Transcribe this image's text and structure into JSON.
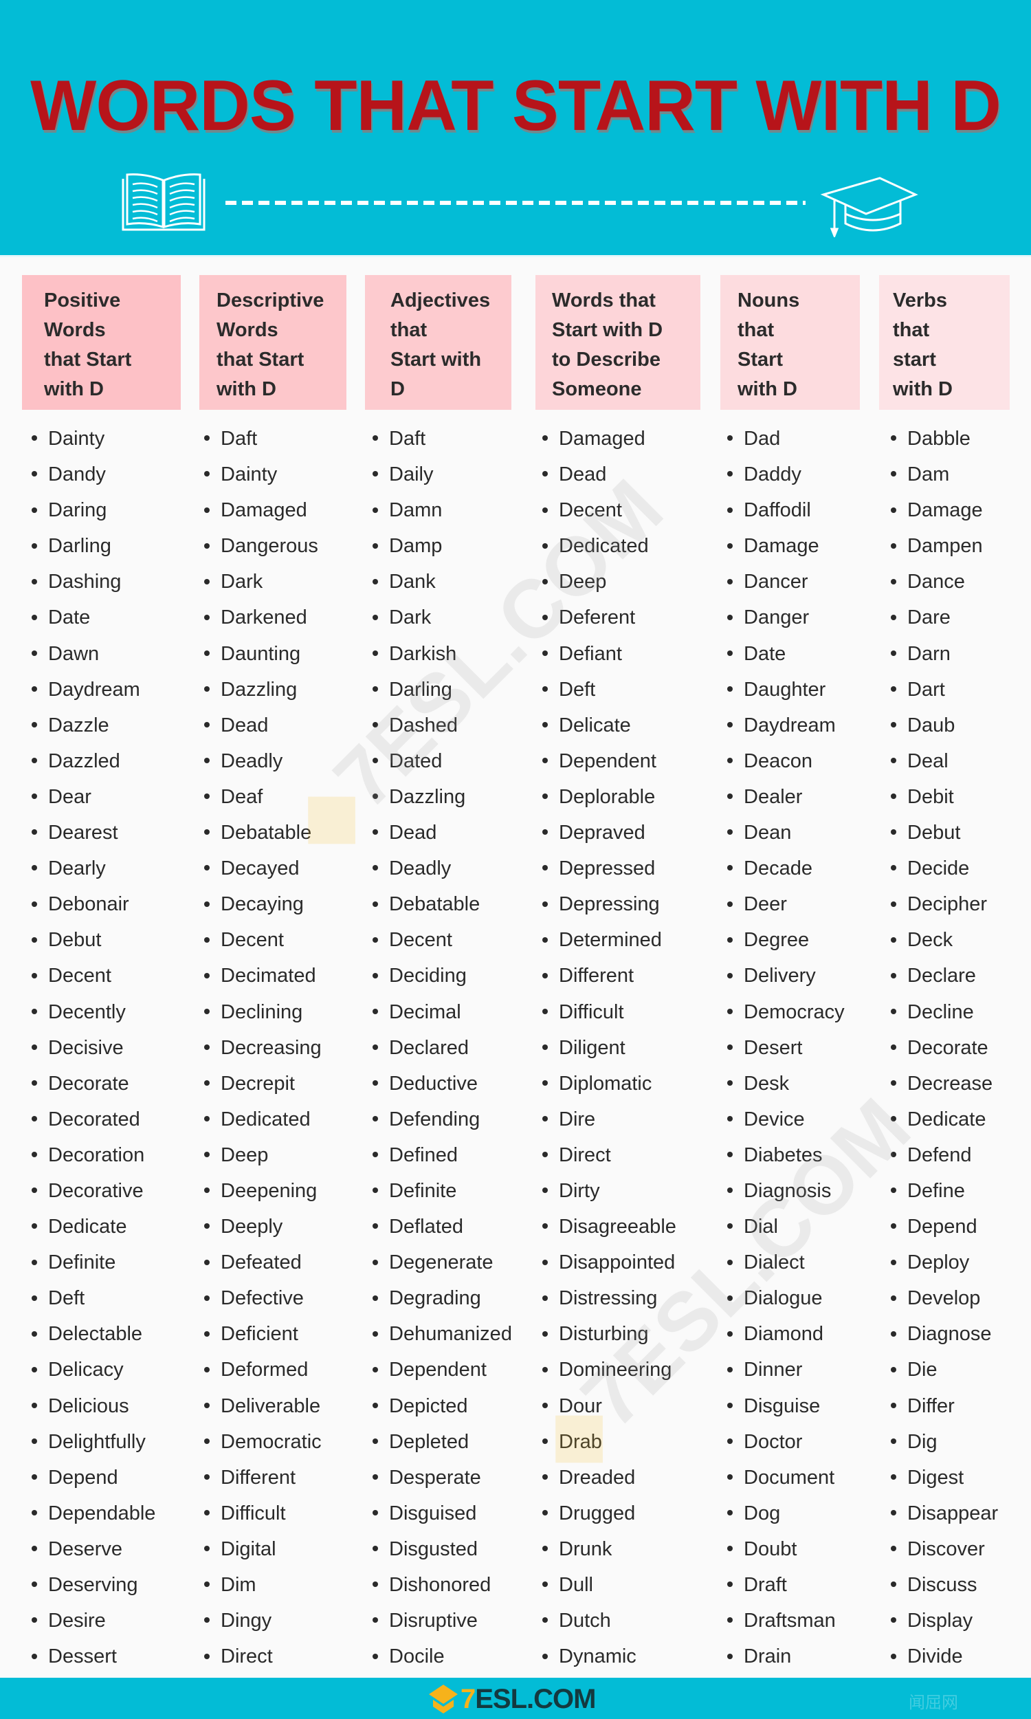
{
  "title": "WORDS THAT START WITH D",
  "colors": {
    "banner": "#03bcd6",
    "title": "#b7141a",
    "header_box_1": "#fdc1c6",
    "header_box_2": "#fdc7cb",
    "header_box_3": "#fdcbcf",
    "header_box_4": "#fdd5d9",
    "header_box_5": "#fddcdf",
    "header_box_6": "#fde3e6",
    "logo_accent": "#f6b21b"
  },
  "icons": {
    "left": "open-book-icon",
    "right": "graduation-cap-icon"
  },
  "columns": [
    {
      "header": [
        "Positive",
        "Words",
        "that Start",
        "with D"
      ],
      "words": [
        "Dainty",
        "Dandy",
        "Daring",
        "Darling",
        "Dashing",
        "Date",
        "Dawn",
        "Daydream",
        "Dazzle",
        "Dazzled",
        "Dear",
        "Dearest",
        "Dearly",
        "Debonair",
        "Debut",
        "Decent",
        "Decently",
        "Decisive",
        "Decorate",
        "Decorated",
        "Decoration",
        "Decorative",
        "Dedicate",
        "Definite",
        "Deft",
        "Delectable",
        "Delicacy",
        "Delicious",
        "Delightfully",
        "Depend",
        "Dependable",
        "Deserve",
        "Deserving",
        "Desire",
        "Dessert"
      ]
    },
    {
      "header": [
        "Descriptive",
        "Words",
        "that Start",
        "with D"
      ],
      "words": [
        "Daft",
        "Dainty",
        "Damaged",
        "Dangerous",
        "Dark",
        "Darkened",
        "Daunting",
        "Dazzling",
        "Dead",
        "Deadly",
        "Deaf",
        "Debatable",
        "Decayed",
        "Decaying",
        "Decent",
        "Decimated",
        "Declining",
        "Decreasing",
        "Decrepit",
        "Dedicated",
        "Deep",
        "Deepening",
        "Deeply",
        "Defeated",
        "Defective",
        "Deficient",
        "Deformed",
        "Deliverable",
        "Democratic",
        "Different",
        "Difficult",
        "Digital",
        "Dim",
        "Dingy",
        "Direct"
      ]
    },
    {
      "header": [
        "Adjectives",
        "that",
        "Start with",
        "D"
      ],
      "words": [
        "Daft",
        "Daily",
        "Damn",
        "Damp",
        "Dank",
        "Dark",
        "Darkish",
        "Darling",
        "Dashed",
        "Dated",
        "Dazzling",
        "Dead",
        "Deadly",
        "Debatable",
        "Decent",
        "Deciding",
        "Decimal",
        "Declared",
        "Deductive",
        "Defending",
        "Defined",
        "Definite",
        "Deflated",
        "Degenerate",
        "Degrading",
        "Dehumanized",
        "Dependent",
        "Depicted",
        "Depleted",
        "Desperate",
        "Disguised",
        "Disgusted",
        "Dishonored",
        "Disruptive",
        "Docile"
      ]
    },
    {
      "header": [
        "Words that",
        "Start with D",
        "to Describe",
        "Someone"
      ],
      "words": [
        "Damaged",
        "Dead",
        "Decent",
        "Dedicated",
        "Deep",
        "Deferent",
        "Defiant",
        "Deft",
        "Delicate",
        "Dependent",
        "Deplorable",
        "Depraved",
        "Depressed",
        "Depressing",
        "Determined",
        "Different",
        "Difficult",
        "Diligent",
        "Diplomatic",
        "Dire",
        "Direct",
        "Dirty",
        "Disagreeable",
        "Disappointed",
        "Distressing",
        "Disturbing",
        "Domineering",
        "Dour",
        "Drab",
        "Dreaded",
        "Drugged",
        "Drunk",
        "Dull",
        "Dutch",
        "Dynamic"
      ]
    },
    {
      "header": [
        "Nouns",
        "that",
        "Start",
        "with D"
      ],
      "words": [
        "Dad",
        "Daddy",
        "Daffodil",
        "Damage",
        "Dancer",
        "Danger",
        "Date",
        "Daughter",
        "Daydream",
        "Deacon",
        "Dealer",
        "Dean",
        "Decade",
        "Deer",
        "Degree",
        "Delivery",
        "Democracy",
        "Desert",
        "Desk",
        "Device",
        "Diabetes",
        "Diagnosis",
        "Dial",
        "Dialect",
        "Dialogue",
        "Diamond",
        "Dinner",
        "Disguise",
        "Doctor",
        "Document",
        "Dog",
        "Doubt",
        "Draft",
        "Draftsman",
        "Drain"
      ]
    },
    {
      "header": [
        "Verbs",
        "that",
        "start",
        "with D"
      ],
      "words": [
        "Dabble",
        "Dam",
        "Damage",
        "Dampen",
        "Dance",
        "Dare",
        "Darn",
        "Dart",
        "Daub",
        "Deal",
        "Debit",
        "Debut",
        "Decide",
        "Decipher",
        "Deck",
        "Declare",
        "Decline",
        "Decorate",
        "Decrease",
        "Dedicate",
        "Defend",
        "Define",
        "Depend",
        "Deploy",
        "Develop",
        "Diagnose",
        "Die",
        "Differ",
        "Dig",
        "Digest",
        "Disappear",
        "Discover",
        "Discuss",
        "Display",
        "Divide"
      ]
    }
  ],
  "watermark": {
    "text": "7ESL.COM"
  },
  "footer": {
    "logo_seven": "7",
    "logo_rest": "ESL.COM",
    "corner_text": "闻屈网"
  }
}
